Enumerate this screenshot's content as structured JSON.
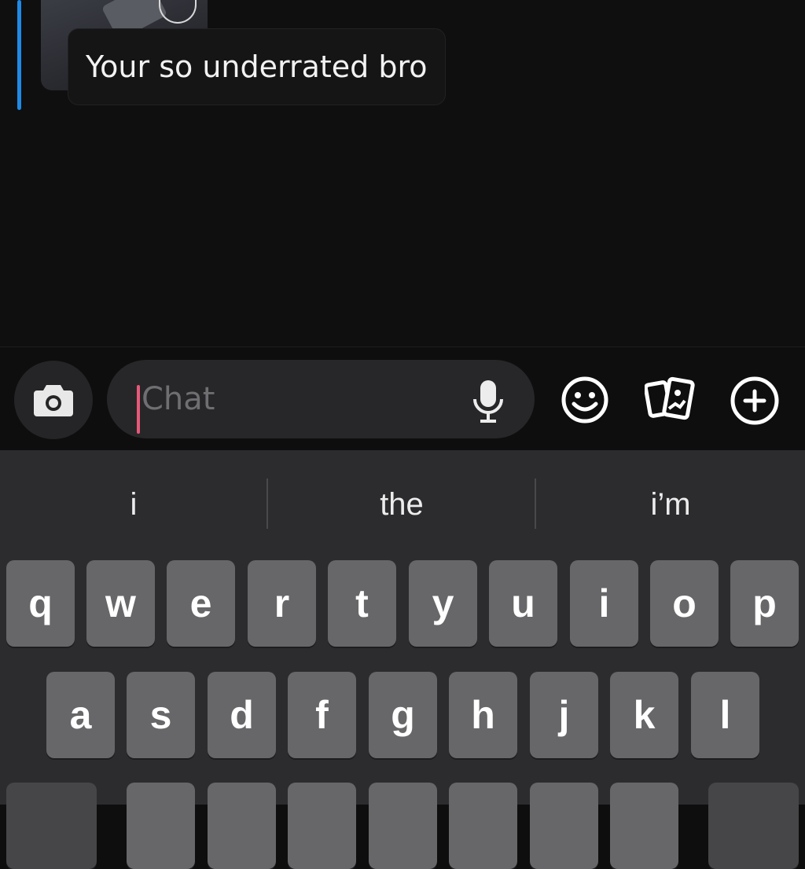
{
  "message": {
    "reply_text": "Your so underrated bro"
  },
  "input": {
    "placeholder": "Chat"
  },
  "toolbar_icons": [
    "camera-icon",
    "microphone-icon",
    "emoji-icon",
    "memories-icon",
    "plus-icon"
  ],
  "keyboard": {
    "suggestions": [
      "i",
      "the",
      "i’m"
    ],
    "row1": [
      "q",
      "w",
      "e",
      "r",
      "t",
      "y",
      "u",
      "i",
      "o",
      "p"
    ],
    "row2": [
      "a",
      "s",
      "d",
      "f",
      "g",
      "h",
      "j",
      "k",
      "l"
    ]
  },
  "colors": {
    "reply_accent": "#1f8ae6",
    "caret": "#e8587a",
    "key": "#676769",
    "keyboard_bg": "#2c2c2e"
  }
}
